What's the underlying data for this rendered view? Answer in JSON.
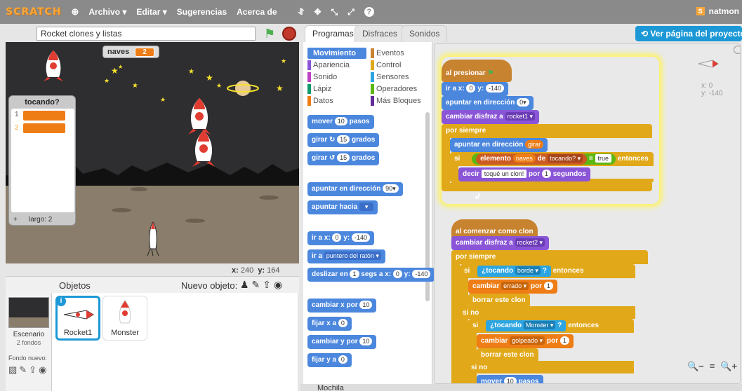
{
  "topbar": {
    "logo": "SCRATCH",
    "menu": [
      "Archivo ▾",
      "Editar ▾",
      "Sugerencias",
      "Acerca de"
    ],
    "tools": [
      "⥯",
      "✥",
      "⤡",
      "⤢",
      "?"
    ],
    "user": "natmon",
    "user_badge": "S"
  },
  "stage": {
    "project_title": "Rocket clones y listas",
    "var_naves_label": "naves",
    "var_naves_value": "2",
    "list_title": "tocando?",
    "list_index1": "1",
    "list_index2": "2",
    "list_footer_add": "+",
    "list_length": "largo: 2",
    "coords_x_label": "x:",
    "coords_x": "240",
    "coords_y_label": "y:",
    "coords_y": "164"
  },
  "sprites": {
    "header": "Objetos",
    "new_sprite": "Nuevo objeto:",
    "stage_name": "Escenario",
    "stage_backdrops": "2 fondos",
    "new_backdrop": "Fondo nuevo:",
    "items": [
      "Rocket1",
      "Monster"
    ],
    "info_badge": "i"
  },
  "tabs": [
    "Programas",
    "Disfraces",
    "Sonidos"
  ],
  "view_project": "Ver página del proyecto",
  "categories": {
    "left": [
      "Movimiento",
      "Apariencia",
      "Sonido",
      "Lápiz",
      "Datos"
    ],
    "right": [
      "Eventos",
      "Control",
      "Sensores",
      "Operadores",
      "Más Bloques"
    ]
  },
  "palette": {
    "move": "mover",
    "move_n": "10",
    "move_s": "pasos",
    "turn_r": "girar ↻",
    "turn_r_n": "15",
    "grados": "grados",
    "turn_l": "girar ↺",
    "turn_l_n": "15",
    "point_dir": "apuntar en dirección",
    "point_dir_v": "90▾",
    "point_to": "apuntar hacia",
    "point_to_v": "▾",
    "goto_xy": "ir a x:",
    "goto_x": "0",
    "goto_y_l": "y:",
    "goto_y": "-140",
    "goto": "ir a",
    "goto_v": "puntero del ratón ▾",
    "glide": "deslizar en",
    "glide_n": "1",
    "glide_s": "segs a x:",
    "glide_x": "0",
    "glide_y_l": "y:",
    "glide_y": "-140",
    "change_x": "cambiar x por",
    "change_x_n": "10",
    "set_x": "fijar x a",
    "set_x_n": "0",
    "change_y": "cambiar y por",
    "change_y_n": "10",
    "set_y": "fijar y a",
    "set_y_n": "0"
  },
  "script1": {
    "hat": "al presionar",
    "goto": "ir a x:",
    "x": "0",
    "y_l": "y:",
    "y": "-140",
    "point": "apuntar en dirección",
    "point_v": "0▾",
    "costume": "cambiar disfraz a",
    "costume_v": "rocket1 ▾",
    "forever": "por siempre",
    "point2": "apuntar en dirección",
    "point2_v": "girar",
    "if": "si",
    "item": "elemento",
    "item_v": "naves",
    "of": "de",
    "list_v": "tocando? ▾",
    "eq": "=",
    "eq_v": "true",
    "then": "entonces",
    "say": "decir",
    "say_v": "toqué un clon!",
    "for": "por",
    "secs_n": "1",
    "secs": "segundos"
  },
  "script2": {
    "hat": "al comenzar como clon",
    "costume": "cambiar disfraz a",
    "costume_v": "rocket2 ▾",
    "forever": "por siempre",
    "if": "si",
    "touching": "¿tocando",
    "touching_v": "borde ▾",
    "q": "?",
    "then": "entonces",
    "change": "cambiar",
    "change_v": "errado ▾",
    "by": "por",
    "by_n": "1",
    "delete": "borrar este clon",
    "else": "si no",
    "touching2_v": "Monster ▾",
    "change2_v": "golpeado ▾",
    "move": "mover",
    "move_n": "10",
    "move_s": "pasos"
  },
  "sprite_info": {
    "x_label": "x:",
    "x": "0",
    "y_label": "y:",
    "y": "-140"
  },
  "zoom": [
    "🔍−",
    "=",
    "🔍+"
  ],
  "backpack": "Mochila",
  "colors": {
    "motion": "#4c87de",
    "looks": "#8a55d7",
    "control": "#e1a91a",
    "events": "#c88330",
    "sensing": "#2ca5e2",
    "operators": "#5cb712",
    "data": "#ee7d16",
    "list": "#cc5b22"
  }
}
